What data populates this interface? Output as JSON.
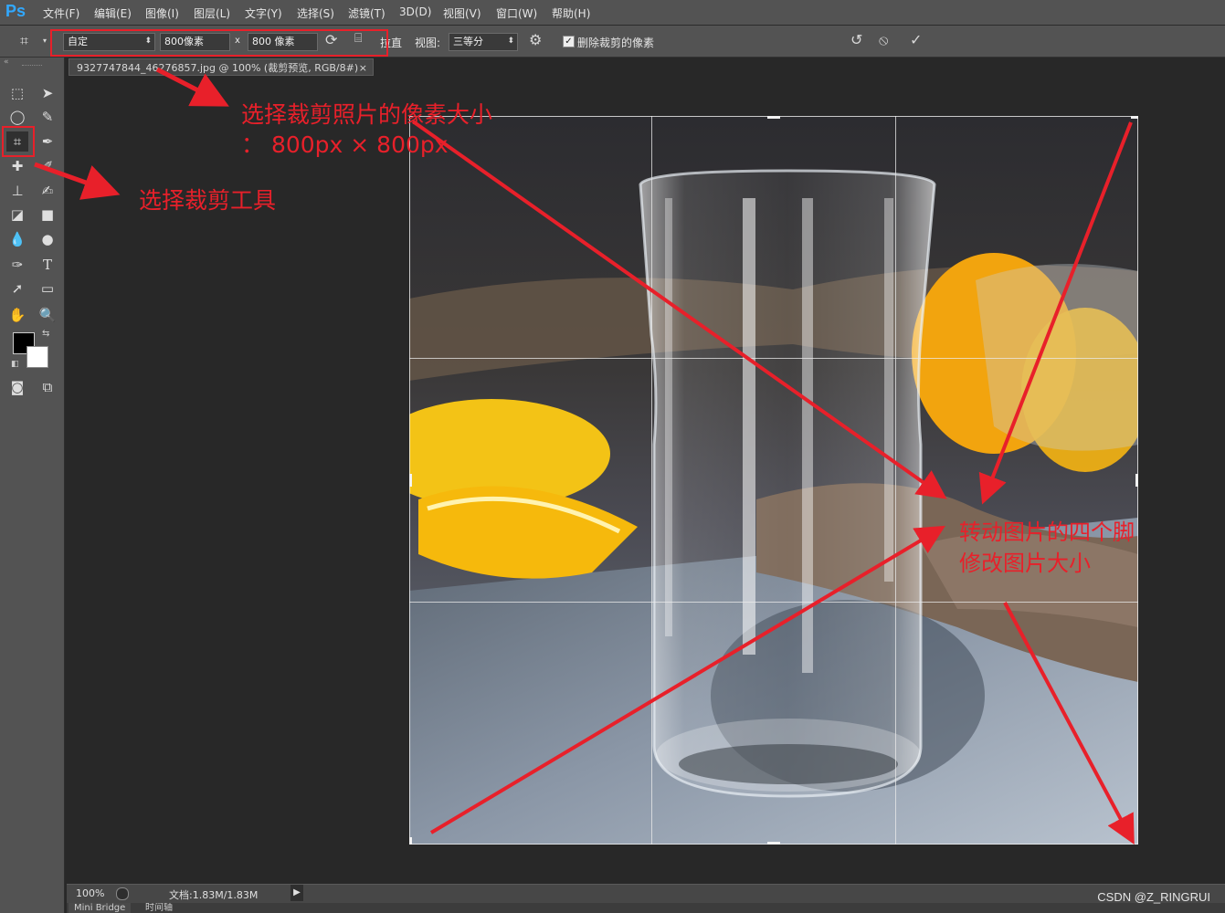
{
  "app": {
    "logo": "Ps"
  },
  "menu": {
    "items": [
      "文件(F)",
      "编辑(E)",
      "图像(I)",
      "图层(L)",
      "文字(Y)",
      "选择(S)",
      "滤镜(T)",
      "3D(D)",
      "视图(V)",
      "窗口(W)",
      "帮助(H)"
    ]
  },
  "options": {
    "preset": "自定",
    "width": "800像素",
    "times": "x",
    "height": "800 像素",
    "straighten": "拉直",
    "view_label": "视图:",
    "view_value": "三等分",
    "delete_cropped_label": "删除裁剪的像素",
    "delete_cropped_checked": true
  },
  "document": {
    "tab_title": "9327747844_46276857.jpg @ 100% (裁剪预览, RGB/8#)",
    "tab_close": "×"
  },
  "status": {
    "zoom": "100%",
    "doc_info": "文档:1.83M/1.83M"
  },
  "bottom_tabs": [
    "Mini Bridge",
    "时间轴"
  ],
  "annotations": {
    "pixel_size_line1": "选择裁剪照片的像素大小",
    "pixel_size_line2": "： 800px × 800px",
    "crop_tool": "选择裁剪工具",
    "handles_line1": "转动图片的四个脚",
    "handles_line2": "修改图片大小"
  },
  "watermark": "CSDN @Z_RINGRUI",
  "colors": {
    "annotation_red": "#e8202a",
    "panel": "#535353",
    "workspace": "#282828",
    "accent_logo": "#31a8ff"
  },
  "icons": {
    "crop_tool": "crop-icon",
    "rotate": "rotate-icon",
    "level": "level-icon",
    "settings": "gear-icon",
    "undo": "undo-icon",
    "cancel": "cancel-icon",
    "commit": "check-icon"
  }
}
